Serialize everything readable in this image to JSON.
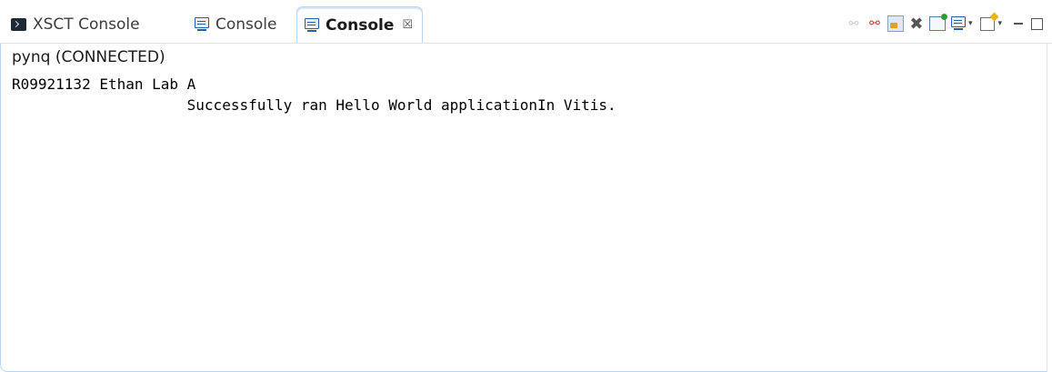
{
  "tabs": [
    {
      "label": "XSCT Console",
      "icon": "terminal-icon",
      "active": false
    },
    {
      "label": "Console",
      "icon": "console-icon",
      "active": false
    },
    {
      "label": "Console",
      "icon": "console-icon",
      "active": true,
      "close_glyph": "☒"
    }
  ],
  "toolbar": {
    "icons": [
      "disconnect-dim-icon",
      "disconnect-icon",
      "scroll-lock-icon",
      "remove-launch-icon",
      "pin-console-icon",
      "display-console-icon",
      "open-console-icon",
      "minimize-icon",
      "maximize-icon"
    ],
    "dropdown_glyph": "▾"
  },
  "console": {
    "connection": "pynq (CONNECTED)",
    "lines": [
      "R09921132 Ethan Lab A",
      "                    Successfully ran Hello World applicationIn Vitis."
    ]
  },
  "colors": {
    "active_tab_border": "#b8d4f0",
    "console_icon": "#2a5ea8",
    "text": "#000000"
  }
}
